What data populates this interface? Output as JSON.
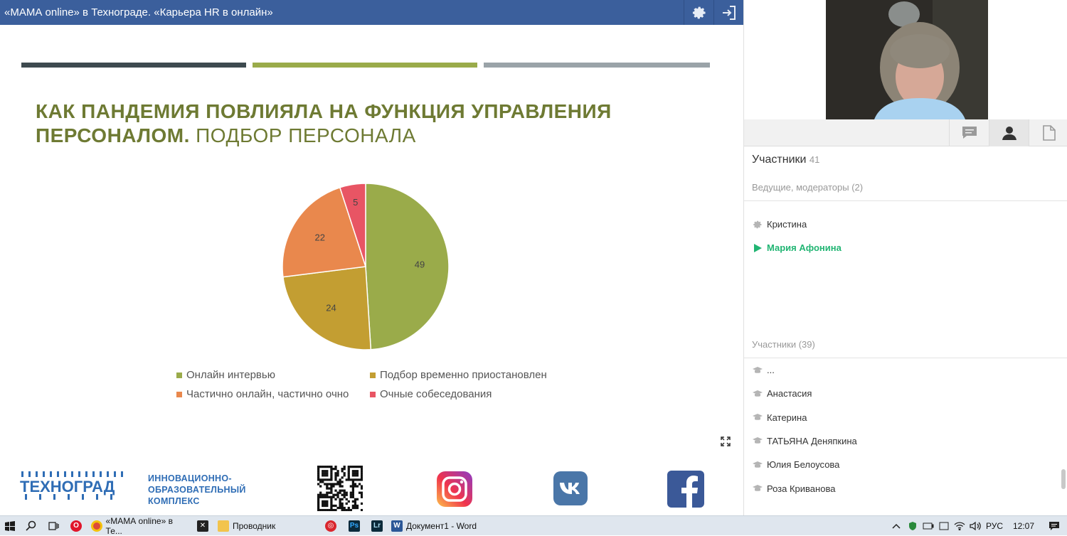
{
  "header": {
    "title": "«МАМА online» в Технограде. «Карьера HR в онлайн»"
  },
  "slide": {
    "title_bold": "КАК ПАНДЕМИЯ ПОВЛИЯЛА НА ФУНКЦИЯ УПРАВЛЕНИЯ ПЕРСОНАЛОМ.",
    "title_thin": " ПОДБОР ПЕРСОНАЛА",
    "stripe_colors": [
      "#3e4a4f",
      "#9aab4a",
      "#9aa3a8"
    ]
  },
  "chart_data": {
    "type": "pie",
    "categories": [
      "Онлайн интервью",
      "Подбор временно приостановлен",
      "Частично онлайн, частично очно",
      "Очные собеседования"
    ],
    "values": [
      49,
      24,
      22,
      5
    ],
    "colors": [
      "#9aab4a",
      "#c39e32",
      "#e9884d",
      "#e85564"
    ],
    "legend": "bottom"
  },
  "footer": {
    "logo_text": "ТЕХНОГРАД",
    "tagline": [
      "ИННОВАЦИОННО-",
      "ОБРАЗОВАТЕЛЬНЫЙ",
      "КОМПЛЕКС"
    ]
  },
  "panel": {
    "participants_label": "Участники",
    "participants_count": "41",
    "moderators_label": "Ведущие, модераторы (2)",
    "moderators": [
      {
        "name": "Кристина",
        "icon": "gear-icon"
      },
      {
        "name": "Мария Афонина",
        "icon": "play-icon"
      }
    ],
    "users_label": "Участники (39)",
    "users": [
      "...",
      "Анастасия",
      "Катерина",
      "ТАТЬЯНА Деняпкина",
      "Юлия Белоусова",
      "Роза Криванова"
    ]
  },
  "taskbar": {
    "chrome_label": "«МАМА online» в Те...",
    "explorer_label": "Проводник",
    "word_label": "Документ1 - Word",
    "lang": "РУС",
    "time": "12:07"
  }
}
